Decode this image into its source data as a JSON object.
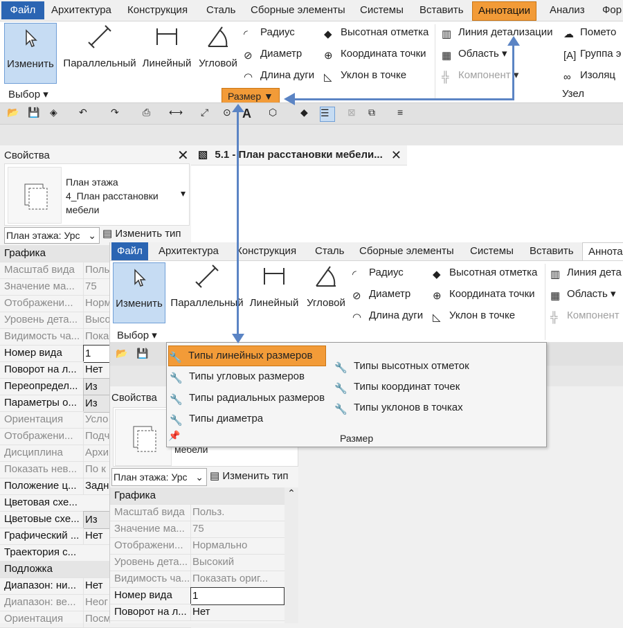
{
  "back": {
    "tabs": [
      "Файл",
      "Архитектура",
      "Конструкция",
      "Сталь",
      "Сборные элементы",
      "Системы",
      "Вставить",
      "Аннотации",
      "Анализ",
      "Фор"
    ],
    "modify_label": "Изменить",
    "select_label": "Выбор",
    "dim_buttons": [
      "Параллельный",
      "Линейный",
      "Угловой"
    ],
    "dim_cmds": [
      "Радиус",
      "Диаметр",
      "Длина дуги"
    ],
    "spot_cmds": [
      "Высотная отметка",
      "Координата точки",
      "Уклон  в точке"
    ],
    "detail_cmds": [
      "Линия детализации",
      "Область",
      "Компонент"
    ],
    "tag_cmds": [
      "Помето",
      "Группа э",
      "Изоляц"
    ],
    "size_panel_label": "Размер",
    "node_panel_label": "Узел"
  },
  "properties": {
    "title": "Свойства",
    "type_line1": "План этажа",
    "type_line2": "4_План расстановки",
    "type_line3": "мебели",
    "filter_value": "План этажа: Урс",
    "edit_type": "Изменить тип",
    "rows": [
      {
        "name": "Графика",
        "value": "",
        "section": true
      },
      {
        "name": "Масштаб вида",
        "value": "Польз.",
        "grey": true
      },
      {
        "name": "Значение ма...",
        "value": "75",
        "grey": true
      },
      {
        "name": "Отображени...",
        "value": "Норм",
        "grey": true
      },
      {
        "name": "Уровень дета...",
        "value": "Высо",
        "grey": true
      },
      {
        "name": "Видимость ча...",
        "value": "Пока",
        "grey": true
      },
      {
        "name": "Номер вида",
        "value": "1"
      },
      {
        "name": "Поворот на л...",
        "value": "Нет"
      },
      {
        "name": "Переопредел...",
        "value": "Из"
      },
      {
        "name": "Параметры о...",
        "value": "Из"
      },
      {
        "name": "Ориентация",
        "value": "Усло",
        "grey": true
      },
      {
        "name": "Отображени...",
        "value": "Подч",
        "grey": true
      },
      {
        "name": "Дисциплина",
        "value": "Архи",
        "grey": true
      },
      {
        "name": "Показать нев...",
        "value": "По к",
        "grey": true
      },
      {
        "name": "Положение ц...",
        "value": "Задн"
      },
      {
        "name": "Цветовая схе...",
        "value": ""
      },
      {
        "name": "Цветовые схе...",
        "value": "Из"
      },
      {
        "name": "Графический ...",
        "value": "Нет"
      },
      {
        "name": "Траектория с...",
        "value": ""
      },
      {
        "name": "Подложка",
        "value": "",
        "section": true
      },
      {
        "name": "Диапазон: ни...",
        "value": "Нет"
      },
      {
        "name": "Диапазон: ве...",
        "value": "Неог",
        "grey": true
      },
      {
        "name": "Ориентация",
        "value": "Посм",
        "grey": true
      }
    ]
  },
  "view_tab": {
    "title": "5.1 - План расстановки мебели..."
  },
  "front": {
    "tabs": [
      "Файл",
      "Архитектура",
      "Конструкция",
      "Сталь",
      "Сборные элементы",
      "Системы",
      "Вставить",
      "Аннота"
    ],
    "modify_label": "Изменить",
    "select_label": "Выбор",
    "dim_buttons": [
      "Параллельный",
      "Линейный",
      "Угловой"
    ],
    "dim_cmds": [
      "Радиус",
      "Диаметр",
      "Длина дуги"
    ],
    "spot_cmds": [
      "Высотная отметка",
      "Координата точки",
      "Уклон  в точке"
    ],
    "detail_cmds": [
      "Линия дета",
      "Область",
      "Компонент"
    ],
    "props_title": "Свойства",
    "props_type_line": "мебели",
    "filter_value": "План этажа: Урс",
    "edit_type": "Изменить тип",
    "rows": [
      {
        "name": "Графика",
        "value": "",
        "section": true
      },
      {
        "name": "Масштаб вида",
        "value": "Польз.",
        "grey": true
      },
      {
        "name": "Значение ма...",
        "value": "75",
        "grey": true
      },
      {
        "name": "Отображени...",
        "value": "Нормально",
        "grey": true
      },
      {
        "name": "Уровень дета...",
        "value": "Высокий",
        "grey": true
      },
      {
        "name": "Видимость ча...",
        "value": "Показать ориг...",
        "grey": true
      },
      {
        "name": "Номер вида",
        "value": "1"
      },
      {
        "name": "Поворот на л...",
        "value": "Нет"
      }
    ]
  },
  "dropdown": {
    "left": [
      "Типы линейных размеров",
      "Типы угловых размеров",
      "Типы радиальных размеров",
      "Типы диаметра"
    ],
    "right": [
      "Типы высотных отметок",
      "Типы координат точек",
      "Типы уклонов в точках"
    ],
    "footer": "Размер"
  },
  "colors": {
    "accent": "#f29b38",
    "file_tab": "#2b65b3",
    "arrow": "#5b84c4",
    "select_bg": "#c6dcf3"
  }
}
